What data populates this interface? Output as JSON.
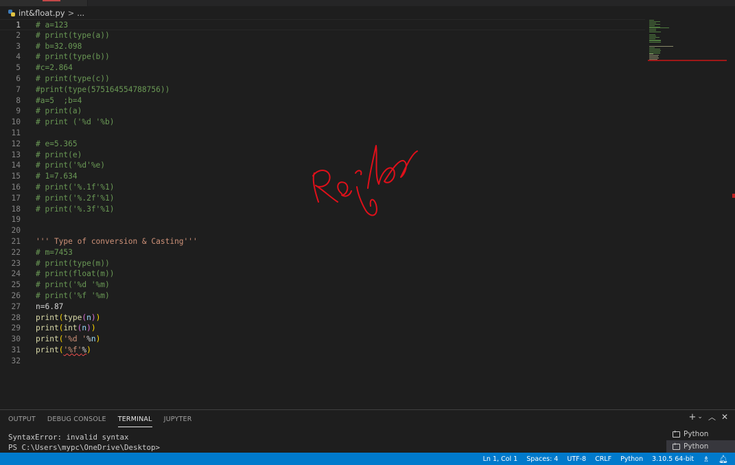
{
  "breadcrumb": {
    "file": "int&float.py",
    "separator": ">",
    "more": "..."
  },
  "editor": {
    "lines": [
      {
        "n": "1",
        "parts": [
          {
            "t": "# a=123",
            "c": "cm"
          }
        ]
      },
      {
        "n": "2",
        "parts": [
          {
            "t": "# print(type(a))",
            "c": "cm"
          }
        ]
      },
      {
        "n": "3",
        "parts": [
          {
            "t": "# b=32.098",
            "c": "cm"
          }
        ]
      },
      {
        "n": "4",
        "parts": [
          {
            "t": "# print(type(b))",
            "c": "cm"
          }
        ]
      },
      {
        "n": "5",
        "parts": [
          {
            "t": "#c=2.864",
            "c": "cm"
          }
        ]
      },
      {
        "n": "6",
        "parts": [
          {
            "t": "# print(type(c))",
            "c": "cm"
          }
        ]
      },
      {
        "n": "7",
        "parts": [
          {
            "t": "#print(type(575164554788756))",
            "c": "cm"
          }
        ]
      },
      {
        "n": "8",
        "parts": [
          {
            "t": "#a=5  ;b=4",
            "c": "cm"
          }
        ]
      },
      {
        "n": "9",
        "parts": [
          {
            "t": "# print(a)",
            "c": "cm"
          }
        ]
      },
      {
        "n": "10",
        "parts": [
          {
            "t": "# print ('%d '%b)",
            "c": "cm"
          }
        ]
      },
      {
        "n": "11",
        "parts": []
      },
      {
        "n": "12",
        "parts": [
          {
            "t": "# e=5.365",
            "c": "cm"
          }
        ]
      },
      {
        "n": "13",
        "parts": [
          {
            "t": "# print(e)",
            "c": "cm"
          }
        ]
      },
      {
        "n": "14",
        "parts": [
          {
            "t": "# print('%d'%e)",
            "c": "cm"
          }
        ]
      },
      {
        "n": "15",
        "parts": [
          {
            "t": "# 1=7.634",
            "c": "cm"
          }
        ]
      },
      {
        "n": "16",
        "parts": [
          {
            "t": "# print('%.1f'%1)",
            "c": "cm"
          }
        ]
      },
      {
        "n": "17",
        "parts": [
          {
            "t": "# print('%.2f'%1)",
            "c": "cm"
          }
        ]
      },
      {
        "n": "18",
        "parts": [
          {
            "t": "# print('%.3f'%1)",
            "c": "cm"
          }
        ]
      },
      {
        "n": "19",
        "parts": []
      },
      {
        "n": "20",
        "parts": []
      },
      {
        "n": "21",
        "parts": [
          {
            "t": "''' Type of conversion & Casting'''",
            "c": "str"
          }
        ]
      },
      {
        "n": "22",
        "parts": [
          {
            "t": "# m=7453",
            "c": "cm"
          }
        ]
      },
      {
        "n": "23",
        "parts": [
          {
            "t": "# print(type(m))",
            "c": "cm"
          }
        ]
      },
      {
        "n": "24",
        "parts": [
          {
            "t": "# print(float(m))",
            "c": "cm"
          }
        ]
      },
      {
        "n": "25",
        "parts": [
          {
            "t": "# print('%d '%m)",
            "c": "cm"
          }
        ]
      },
      {
        "n": "26",
        "parts": [
          {
            "t": "# print('%f '%m)",
            "c": "cm"
          }
        ]
      },
      {
        "n": "27",
        "parts": [
          {
            "t": "n=6.87",
            "c": "pl"
          }
        ]
      },
      {
        "n": "28",
        "parts": [
          {
            "t": "print",
            "c": "fn"
          },
          {
            "t": "(",
            "c": "br"
          },
          {
            "t": "type",
            "c": "fn"
          },
          {
            "t": "(",
            "c": "br2"
          },
          {
            "t": "n",
            "c": "vr"
          },
          {
            "t": ")",
            "c": "br2"
          },
          {
            "t": ")",
            "c": "br"
          }
        ]
      },
      {
        "n": "29",
        "parts": [
          {
            "t": "print",
            "c": "fn"
          },
          {
            "t": "(",
            "c": "br"
          },
          {
            "t": "int",
            "c": "fn"
          },
          {
            "t": "(",
            "c": "br2"
          },
          {
            "t": "n",
            "c": "vr"
          },
          {
            "t": ")",
            "c": "br2"
          },
          {
            "t": ")",
            "c": "br"
          }
        ]
      },
      {
        "n": "30",
        "parts": [
          {
            "t": "print",
            "c": "fn"
          },
          {
            "t": "(",
            "c": "br"
          },
          {
            "t": "'%d '",
            "c": "str"
          },
          {
            "t": "%",
            "c": "pl"
          },
          {
            "t": "n",
            "c": "vr"
          },
          {
            "t": ")",
            "c": "br"
          }
        ]
      },
      {
        "n": "31",
        "parts": [
          {
            "t": "print",
            "c": "fn"
          },
          {
            "t": "(",
            "c": "br"
          },
          {
            "t": "'%f'",
            "c": "str err"
          },
          {
            "t": "%",
            "c": "pl err"
          },
          {
            "t": ")",
            "c": "br"
          }
        ]
      },
      {
        "n": "32",
        "parts": []
      }
    ]
  },
  "panel": {
    "tabs": [
      "OUTPUT",
      "DEBUG CONSOLE",
      "TERMINAL",
      "JUPYTER"
    ],
    "active_tab": "TERMINAL",
    "terminal_lines": [
      "SyntaxError: invalid syntax",
      "PS C:\\Users\\mypc\\OneDrive\\Desktop>"
    ],
    "terminals": [
      "Python",
      "Python"
    ]
  },
  "statusbar": {
    "position": "Ln 1, Col 1",
    "spaces": "Spaces: 4",
    "encoding": "UTF-8",
    "eol": "CRLF",
    "language": "Python",
    "interpreter": "3.10.5 64-bit"
  },
  "colors": {
    "accent": "#007acc",
    "comment": "#6a9955",
    "string": "#ce9178",
    "signature": "#e0101a"
  }
}
